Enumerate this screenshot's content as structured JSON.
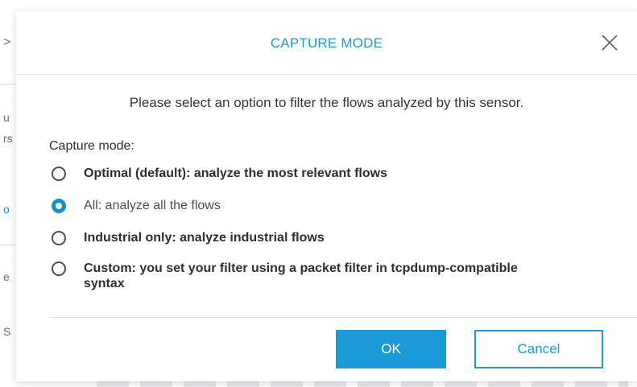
{
  "background": {
    "glyphs": [
      ">",
      "u",
      "rs",
      "o",
      "e",
      "S"
    ]
  },
  "modal": {
    "title": "CAPTURE MODE",
    "description": "Please select an option to filter the flows analyzed by this sensor.",
    "field_label": "Capture mode:",
    "options": [
      {
        "label": "Optimal (default): analyze the most relevant flows",
        "checked": false
      },
      {
        "label": "All: analyze all the flows",
        "checked": true
      },
      {
        "label": "Industrial only: analyze industrial flows",
        "checked": false
      },
      {
        "label": "Custom: you set your filter using a packet filter in tcpdump-compatible syntax",
        "checked": false
      }
    ],
    "ok_label": "OK",
    "cancel_label": "Cancel"
  },
  "colors": {
    "accent": "#1a9ad6",
    "text": "#2c2f31"
  },
  "icons": {
    "close": "close-icon"
  }
}
